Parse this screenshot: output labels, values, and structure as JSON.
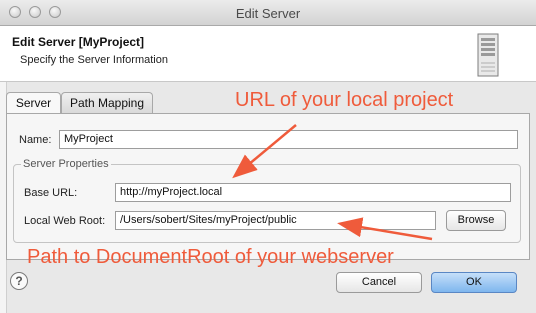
{
  "window": {
    "title": "Edit Server"
  },
  "banner": {
    "title": "Edit Server [MyProject]",
    "subtitle": "Specify the Server Information"
  },
  "tabs": [
    {
      "label": "Server",
      "active": true
    },
    {
      "label": "Path Mapping",
      "active": false
    }
  ],
  "form": {
    "name_label": "Name:",
    "name_value": "MyProject",
    "group_label": "Server Properties",
    "base_url_label": "Base URL:",
    "base_url_value": "http://myProject.local",
    "web_root_label": "Local Web Root:",
    "web_root_value": "/Users/sobert/Sites/myProject/public",
    "browse_label": "Browse"
  },
  "buttons": {
    "help": "?",
    "cancel": "Cancel",
    "ok": "OK"
  },
  "annotations": {
    "url_note": "URL of your local project",
    "path_note": "Path to DocumentRoot of your webserver",
    "color": "#ef5b3b"
  }
}
